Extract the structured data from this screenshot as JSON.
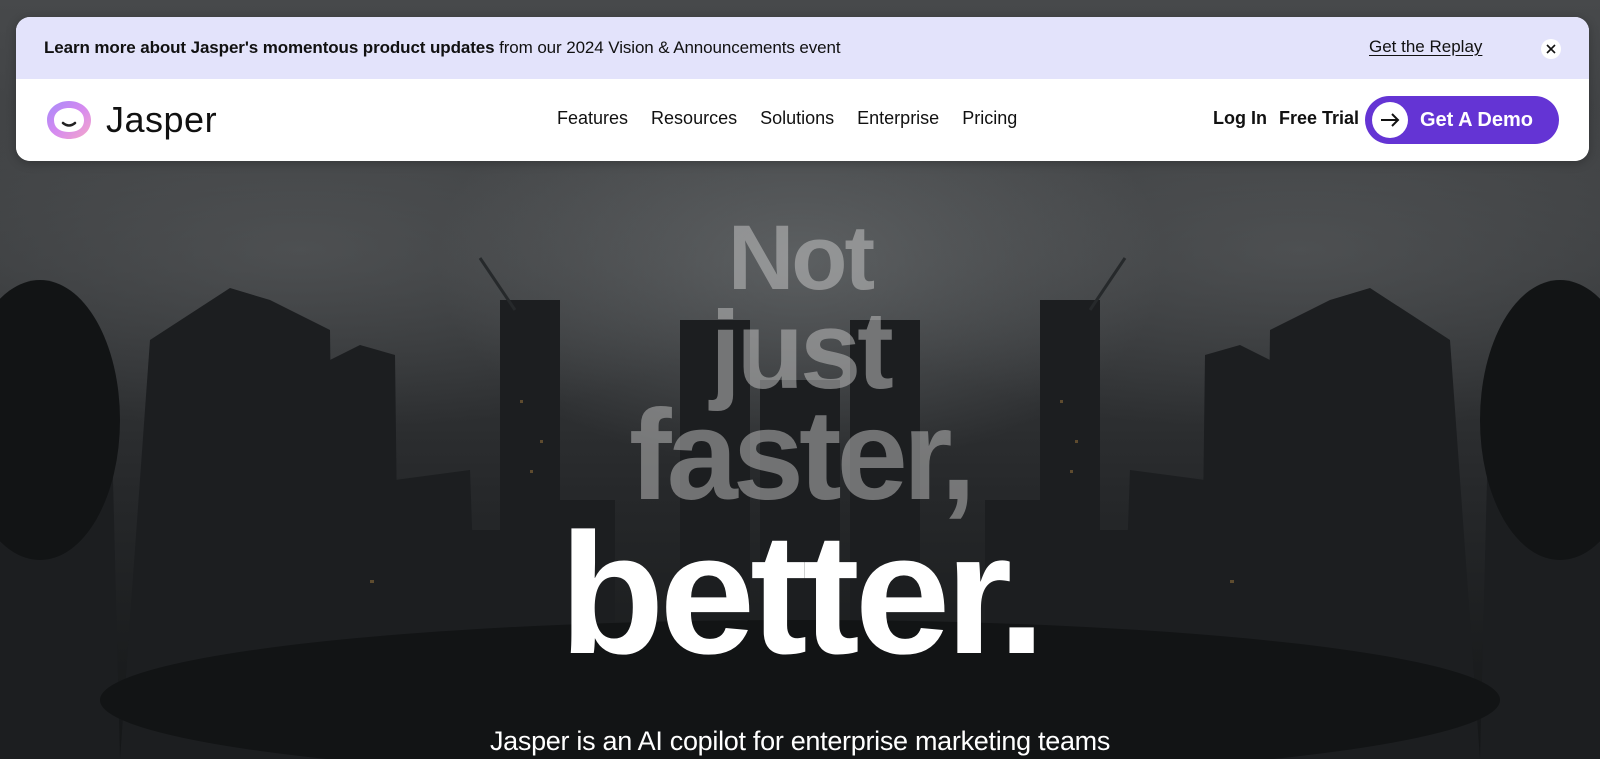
{
  "announcement": {
    "bold_text": "Learn more about Jasper's momentous product updates",
    "text": " from our 2024 Vision & Announcements event",
    "link_label": "Get the Replay",
    "close_icon": "close-icon"
  },
  "nav": {
    "logo_text": "Jasper",
    "links": [
      "Features",
      "Resources",
      "Solutions",
      "Enterprise",
      "Pricing"
    ],
    "login_label": "Log In",
    "free_trial_label": "Free Trial",
    "demo_label": "Get A Demo",
    "demo_icon": "arrow-right-icon"
  },
  "hero": {
    "line1": "Not",
    "line2": "just",
    "line3": "faster,",
    "line4": "better.",
    "subheading": "Jasper is an AI copilot for enterprise marketing teams"
  },
  "colors": {
    "accent": "#6434d4",
    "announcement_bg": "#e3e3fb"
  }
}
